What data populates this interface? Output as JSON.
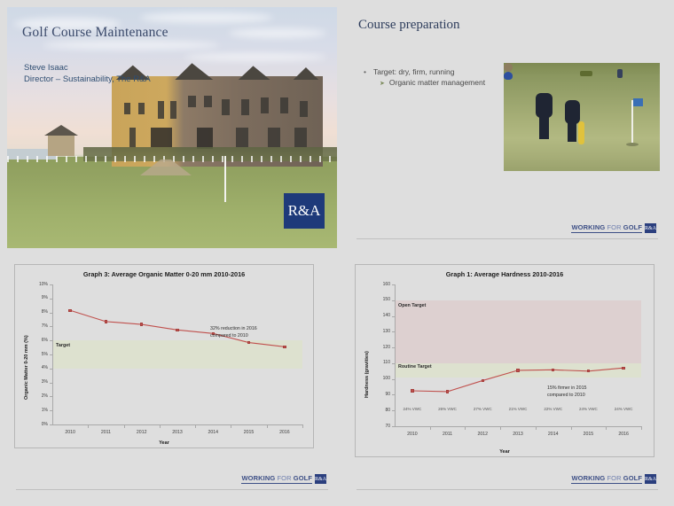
{
  "deck": {
    "background_color": "#dedede",
    "slide_count": 4
  },
  "slide1": {
    "title": "Golf Course Maintenance",
    "presenter": "Steve Isaac",
    "role": "Director – Sustainability, The R&A",
    "logo_text": "R&A",
    "image_alt": "St Andrews clubhouse behind the 18th green at dusk"
  },
  "slide2": {
    "title": "Course preparation",
    "bullets": [
      {
        "level": 1,
        "text": "Target: dry, firm, running",
        "marker": "bullet-dot"
      },
      {
        "level": 2,
        "text": "Organic matter management",
        "marker": "bullet-arrow"
      }
    ],
    "image_alt": "Two officials measuring a links green beside the flagstick",
    "footer": {
      "text_bold": "WORKING",
      "text_mid": " FOR ",
      "text_end": "GOLF",
      "badge": "R&A"
    }
  },
  "slide3": {
    "footer": {
      "text_bold": "WORKING",
      "text_mid": " FOR ",
      "text_end": "GOLF",
      "badge": "R&A"
    }
  },
  "slide4": {
    "footer": {
      "text_bold": "WORKING",
      "text_mid": " FOR ",
      "text_end": "GOLF",
      "badge": "R&A"
    }
  },
  "chart_data": [
    {
      "id": "graph3",
      "type": "line",
      "title": "Graph 3: Average Organic Matter 0-20 mm 2010-2016",
      "xlabel": "Year",
      "ylabel": "Organic Matter 0-20 mm (%)",
      "categories": [
        "2010",
        "2011",
        "2012",
        "2013",
        "2014",
        "2015",
        "2016"
      ],
      "values": [
        8.15,
        7.35,
        7.15,
        6.75,
        6.5,
        5.85,
        5.55
      ],
      "ylim": [
        0,
        10
      ],
      "ytick_values": [
        0,
        1,
        2,
        3,
        4,
        5,
        6,
        7,
        8,
        9,
        10
      ],
      "ytick_labels": [
        "0%",
        "1%",
        "2%",
        "3%",
        "4%",
        "5%",
        "6%",
        "7%",
        "8%",
        "9%",
        "10%"
      ],
      "grid": false,
      "legend": "none",
      "series_color": "#c0504d",
      "bands": [
        {
          "label": "Target",
          "from": 4.0,
          "to": 6.0,
          "color": "#dde1cf"
        }
      ],
      "annotations": [
        {
          "text_lines": [
            "32% reduction in 2016",
            "compared to 2010"
          ],
          "x": 2015.0,
          "y": 7.1
        }
      ]
    },
    {
      "id": "graph1",
      "type": "line",
      "title": "Graph 1: Average Hardness 2010-2016",
      "xlabel": "Year",
      "ylabel": "Hardness (gravities)",
      "categories": [
        "2010",
        "2011",
        "2012",
        "2013",
        "2014",
        "2015",
        "2016"
      ],
      "values": [
        92.5,
        92.0,
        99.0,
        105.5,
        105.8,
        105.0,
        107.0
      ],
      "secondary_tick_labels": [
        "24% VWC",
        "26% VWC",
        "27% VWC",
        "21% VWC",
        "22% VWC",
        "24% VWC",
        "24% VWC"
      ],
      "ylim": [
        70,
        160
      ],
      "ytick_values": [
        70,
        80,
        90,
        100,
        110,
        120,
        130,
        140,
        150,
        160
      ],
      "ytick_labels": [
        "70",
        "80",
        "90",
        "100",
        "110",
        "120",
        "130",
        "140",
        "150",
        "160"
      ],
      "grid": false,
      "legend": "none",
      "series_color": "#c0504d",
      "bands": [
        {
          "label": "Open Target",
          "from": 101.0,
          "to": 150.0,
          "color": "#ddd0d0"
        },
        {
          "label": "Routine Target",
          "from": 101.0,
          "to": 110.0,
          "color": "#dde1cf"
        }
      ],
      "annotations": [
        {
          "text_lines": [
            "15% firmer in 2015",
            "compared to 2010"
          ],
          "x": 2015.1,
          "y": 96.5
        }
      ]
    }
  ]
}
